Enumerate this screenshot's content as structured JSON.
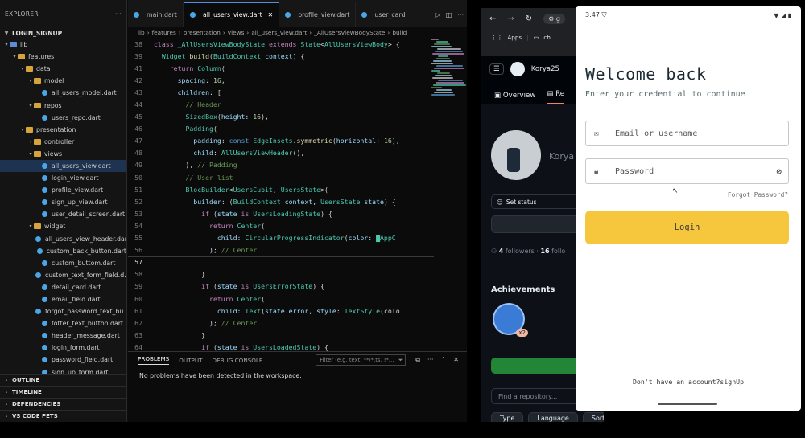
{
  "vscode": {
    "explorer_title": "EXPLORER",
    "project": "LOGIN_SIGNUP",
    "tree": [
      {
        "label": "lib",
        "kind": "folder-blue",
        "depth": 0,
        "open": true
      },
      {
        "label": "features",
        "kind": "folder",
        "depth": 1,
        "open": true
      },
      {
        "label": "data",
        "kind": "folder",
        "depth": 2,
        "open": true
      },
      {
        "label": "model",
        "kind": "folder",
        "depth": 3,
        "open": true
      },
      {
        "label": "all_users_model.dart",
        "kind": "dart",
        "depth": 4
      },
      {
        "label": "repos",
        "kind": "folder",
        "depth": 3,
        "open": true
      },
      {
        "label": "users_repo.dart",
        "kind": "dart",
        "depth": 4
      },
      {
        "label": "presentation",
        "kind": "folder",
        "depth": 2,
        "open": true
      },
      {
        "label": "controller",
        "kind": "folder",
        "depth": 3,
        "open": false
      },
      {
        "label": "views",
        "kind": "folder",
        "depth": 3,
        "open": true
      },
      {
        "label": "all_users_view.dart",
        "kind": "dart",
        "depth": 4,
        "selected": true
      },
      {
        "label": "login_view.dart",
        "kind": "dart",
        "depth": 4
      },
      {
        "label": "profile_view.dart",
        "kind": "dart",
        "depth": 4
      },
      {
        "label": "sign_up_view.dart",
        "kind": "dart",
        "depth": 4
      },
      {
        "label": "user_detail_screen.dart",
        "kind": "dart",
        "depth": 4
      },
      {
        "label": "widget",
        "kind": "folder",
        "depth": 3,
        "open": true
      },
      {
        "label": "all_users_view_header.dart",
        "kind": "dart",
        "depth": 4
      },
      {
        "label": "custom_back_button.dart",
        "kind": "dart",
        "depth": 4
      },
      {
        "label": "custom_buttom.dart",
        "kind": "dart",
        "depth": 4
      },
      {
        "label": "custom_text_form_field.d...",
        "kind": "dart",
        "depth": 4
      },
      {
        "label": "detail_card.dart",
        "kind": "dart",
        "depth": 4
      },
      {
        "label": "email_field.dart",
        "kind": "dart",
        "depth": 4
      },
      {
        "label": "forgot_password_text_bu...",
        "kind": "dart",
        "depth": 4
      },
      {
        "label": "fotter_text_button.dart",
        "kind": "dart",
        "depth": 4
      },
      {
        "label": "header_message.dart",
        "kind": "dart",
        "depth": 4
      },
      {
        "label": "login_form.dart",
        "kind": "dart",
        "depth": 4
      },
      {
        "label": "password_field.dart",
        "kind": "dart",
        "depth": 4
      },
      {
        "label": "sign_up_form.dart",
        "kind": "dart",
        "depth": 4
      }
    ],
    "sections": [
      "OUTLINE",
      "TIMELINE",
      "DEPENDENCIES",
      "VS CODE PETS"
    ],
    "tabs": [
      {
        "label": "main.dart",
        "active": false
      },
      {
        "label": "all_users_view.dart",
        "active": true
      },
      {
        "label": "profile_view.dart",
        "active": false
      },
      {
        "label": "user_card",
        "active": false
      }
    ],
    "breadcrumb": [
      "lib",
      "features",
      "presentation",
      "views",
      "all_users_view.dart",
      "_AllUsersViewBodyState",
      "build"
    ],
    "code": [
      {
        "n": "38",
        "t": [
          [
            "kw",
            "class "
          ],
          [
            "ty",
            "_AllUsersViewBodyState "
          ],
          [
            "kw",
            "extends "
          ],
          [
            "ty",
            "State"
          ],
          [
            "pl",
            "<"
          ],
          [
            "ty",
            "AllUsersViewBody"
          ],
          [
            "pl",
            "> {"
          ]
        ]
      },
      {
        "n": "39",
        "t": [
          [
            "pl",
            "  "
          ],
          [
            "ty",
            "Widget "
          ],
          [
            "fn",
            "build"
          ],
          [
            "pl",
            "("
          ],
          [
            "ty",
            "BuildContext "
          ],
          [
            "pr",
            "context"
          ],
          [
            "pl",
            ") {"
          ]
        ]
      },
      {
        "n": "41",
        "t": [
          [
            "pl",
            "    "
          ],
          [
            "kw",
            "return "
          ],
          [
            "ty",
            "Column"
          ],
          [
            "pl",
            "("
          ]
        ]
      },
      {
        "n": "42",
        "t": [
          [
            "pl",
            "      "
          ],
          [
            "pr",
            "spacing"
          ],
          [
            "pl",
            ": "
          ],
          [
            "nm",
            "16"
          ],
          [
            "pl",
            ","
          ]
        ]
      },
      {
        "n": "43",
        "t": [
          [
            "pl",
            "      "
          ],
          [
            "pr",
            "children"
          ],
          [
            "pl",
            ": ["
          ]
        ]
      },
      {
        "n": "44",
        "t": [
          [
            "pl",
            "        "
          ],
          [
            "cm",
            "// Header"
          ]
        ]
      },
      {
        "n": "45",
        "t": [
          [
            "pl",
            "        "
          ],
          [
            "ty",
            "SizedBox"
          ],
          [
            "pl",
            "("
          ],
          [
            "pr",
            "height"
          ],
          [
            "pl",
            ": "
          ],
          [
            "nm",
            "16"
          ],
          [
            "pl",
            "),"
          ]
        ]
      },
      {
        "n": "46",
        "t": [
          [
            "pl",
            "        "
          ],
          [
            "ty",
            "Padding"
          ],
          [
            "pl",
            "("
          ]
        ]
      },
      {
        "n": "47",
        "t": [
          [
            "pl",
            "          "
          ],
          [
            "pr",
            "padding"
          ],
          [
            "pl",
            ": "
          ],
          [
            "bl",
            "const "
          ],
          [
            "ty",
            "EdgeInsets"
          ],
          [
            "pl",
            "."
          ],
          [
            "fn",
            "symmetric"
          ],
          [
            "pl",
            "("
          ],
          [
            "pr",
            "horizontal"
          ],
          [
            "pl",
            ": "
          ],
          [
            "nm",
            "16"
          ],
          [
            "pl",
            "),"
          ]
        ]
      },
      {
        "n": "48",
        "t": [
          [
            "pl",
            "          "
          ],
          [
            "pr",
            "child"
          ],
          [
            "pl",
            ": "
          ],
          [
            "ty",
            "AllUsersViewHeader"
          ],
          [
            "pl",
            "(),"
          ]
        ]
      },
      {
        "n": "49",
        "t": [
          [
            "pl",
            "        ), "
          ],
          [
            "cm",
            "// Padding"
          ]
        ]
      },
      {
        "n": "50",
        "t": [
          [
            "pl",
            "        "
          ],
          [
            "cm",
            "// User list"
          ]
        ]
      },
      {
        "n": "51",
        "t": [
          [
            "pl",
            "        "
          ],
          [
            "ty",
            "BlocBuilder"
          ],
          [
            "pl",
            "<"
          ],
          [
            "ty",
            "UsersCubit"
          ],
          [
            "pl",
            ", "
          ],
          [
            "ty",
            "UsersState"
          ],
          [
            "pl",
            ">("
          ]
        ]
      },
      {
        "n": "52",
        "t": [
          [
            "pl",
            "          "
          ],
          [
            "pr",
            "builder"
          ],
          [
            "pl",
            ": ("
          ],
          [
            "ty",
            "BuildContext "
          ],
          [
            "pr",
            "context"
          ],
          [
            "pl",
            ", "
          ],
          [
            "ty",
            "UsersState "
          ],
          [
            "pr",
            "state"
          ],
          [
            "pl",
            ") {"
          ]
        ]
      },
      {
        "n": "53",
        "t": [
          [
            "pl",
            "            "
          ],
          [
            "kw",
            "if "
          ],
          [
            "pl",
            "("
          ],
          [
            "pr",
            "state "
          ],
          [
            "kw",
            "is "
          ],
          [
            "ty",
            "UsersLoadingState"
          ],
          [
            "pl",
            ") {"
          ]
        ]
      },
      {
        "n": "54",
        "t": [
          [
            "pl",
            "              "
          ],
          [
            "kw",
            "return "
          ],
          [
            "ty",
            "Center"
          ],
          [
            "pl",
            "("
          ]
        ]
      },
      {
        "n": "55",
        "t": [
          [
            "pl",
            "                "
          ],
          [
            "pr",
            "child"
          ],
          [
            "pl",
            ": "
          ],
          [
            "ty",
            "CircularProgressIndicator"
          ],
          [
            "pl",
            "("
          ],
          [
            "pr",
            "color"
          ],
          [
            "pl",
            ": "
          ],
          [
            "ty",
            "▇AppC"
          ]
        ]
      },
      {
        "n": "56",
        "t": [
          [
            "pl",
            "              ); "
          ],
          [
            "cm",
            "// Center"
          ]
        ]
      },
      {
        "n": "57",
        "t": [
          [
            "pl",
            ""
          ]
        ],
        "cur": true
      },
      {
        "n": "58",
        "t": [
          [
            "pl",
            "            }"
          ]
        ]
      },
      {
        "n": "59",
        "t": [
          [
            "pl",
            "            "
          ],
          [
            "kw",
            "if "
          ],
          [
            "pl",
            "("
          ],
          [
            "pr",
            "state "
          ],
          [
            "kw",
            "is "
          ],
          [
            "ty",
            "UsersErrorState"
          ],
          [
            "pl",
            ") {"
          ]
        ]
      },
      {
        "n": "60",
        "t": [
          [
            "pl",
            "              "
          ],
          [
            "kw",
            "return "
          ],
          [
            "ty",
            "Center"
          ],
          [
            "pl",
            "("
          ]
        ]
      },
      {
        "n": "61",
        "t": [
          [
            "pl",
            "                "
          ],
          [
            "pr",
            "child"
          ],
          [
            "pl",
            ": "
          ],
          [
            "ty",
            "Text"
          ],
          [
            "pl",
            "("
          ],
          [
            "pr",
            "state"
          ],
          [
            "pl",
            "."
          ],
          [
            "pr",
            "error"
          ],
          [
            "pl",
            ", "
          ],
          [
            "pr",
            "style"
          ],
          [
            "pl",
            ": "
          ],
          [
            "ty",
            "TextStyle"
          ],
          [
            "pl",
            "(colo"
          ]
        ]
      },
      {
        "n": "62",
        "t": [
          [
            "pl",
            "              ); "
          ],
          [
            "cm",
            "// Center"
          ]
        ]
      },
      {
        "n": "63",
        "t": [
          [
            "pl",
            "            }"
          ]
        ]
      },
      {
        "n": "64",
        "t": [
          [
            "pl",
            "            "
          ],
          [
            "kw",
            "if "
          ],
          [
            "pl",
            "("
          ],
          [
            "pr",
            "state "
          ],
          [
            "kw",
            "is "
          ],
          [
            "ty",
            "UsersLoadedState"
          ],
          [
            "pl",
            ") {"
          ]
        ]
      },
      {
        "n": "65",
        "t": [
          [
            "pl",
            "              "
          ],
          [
            "kw",
            "return "
          ],
          [
            "ty",
            "Expanded"
          ],
          [
            "pl",
            "("
          ]
        ]
      },
      {
        "n": "66",
        "t": [
          [
            "pl",
            "                "
          ],
          [
            "pr",
            "child"
          ],
          [
            "pl",
            ": "
          ],
          [
            "ty",
            "ListView"
          ],
          [
            "pl",
            "."
          ],
          [
            "fn",
            "builder"
          ],
          [
            "pl",
            "("
          ]
        ]
      },
      {
        "n": "67",
        "t": [
          [
            "pl",
            "                  "
          ],
          [
            "pr",
            "padding"
          ],
          [
            "pl",
            ": "
          ],
          [
            "bl",
            "const "
          ],
          [
            "ty",
            "EdgeInsets"
          ],
          [
            "pl",
            "."
          ],
          [
            "fn",
            "all"
          ],
          [
            "pl",
            "("
          ],
          [
            "nm",
            "16"
          ],
          [
            "pl",
            "),"
          ]
        ]
      },
      {
        "n": "68",
        "t": [
          [
            "pl",
            "                  "
          ],
          [
            "pr",
            "itemCount"
          ],
          [
            "pl",
            ": "
          ],
          [
            "pr",
            "state"
          ],
          [
            "pl",
            "."
          ],
          [
            "pr",
            "users"
          ],
          [
            "pl",
            "."
          ],
          [
            "pr",
            "length"
          ],
          [
            "pl",
            ","
          ]
        ]
      }
    ],
    "panel_tabs": [
      "PROBLEMS",
      "OUTPUT",
      "DEBUG CONSOLE",
      "..."
    ],
    "panel_filter_placeholder": "Filter (e.g. text, **/*.ts, !*...",
    "panel_message": "No problems have been detected in the workspace."
  },
  "browser": {
    "tab_partial": "g",
    "bookmarks": [
      "Apps",
      "ch"
    ],
    "username": "Korya25",
    "tabs": [
      "Overview",
      "Re"
    ],
    "display_name": "Korya",
    "set_status": "Set status",
    "followers": "4",
    "followers_label": "followers",
    "following": "16",
    "following_label": "follo",
    "achievements_title": "Achievements",
    "badge_count": "x2",
    "repo_search_placeholder": "Find a repository...",
    "filters": [
      "Type",
      "Language",
      "Sort"
    ]
  },
  "phone": {
    "time": "3:47",
    "title": "Welcome back",
    "subtitle": "Enter your credential to continue",
    "email_placeholder": "Email or username",
    "password_placeholder": "Password",
    "forgot": "Forgot Password?",
    "login_label": "Login",
    "signup_text": "Don't have an account?signUp",
    "accent": "#f6c63d"
  }
}
